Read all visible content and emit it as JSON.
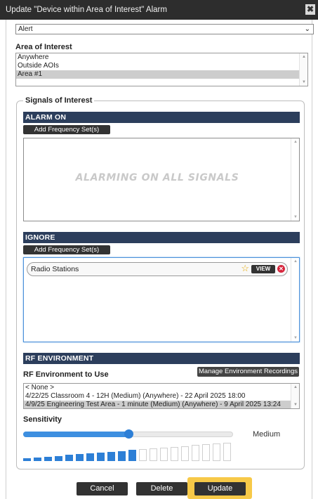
{
  "titlebar": {
    "title": "Update \"Device within Area of Interest\" Alarm",
    "close": "✖"
  },
  "alarm_type": {
    "value": "Alert",
    "arrow": "⌄"
  },
  "aoi": {
    "label": "Area of Interest",
    "options": [
      "Anywhere",
      "Outside AOIs",
      "Area #1"
    ],
    "selected_index": 2
  },
  "signals": {
    "legend": "Signals of Interest",
    "alarm_on": {
      "header": "ALARM ON",
      "add_button": "Add Frequency Set(s)",
      "placeholder": "ALARMING ON ALL SIGNALS"
    },
    "ignore": {
      "header": "IGNORE",
      "add_button": "Add Frequency Set(s)",
      "items": [
        {
          "label": "Radio Stations",
          "view_label": "VIEW"
        }
      ]
    },
    "rf": {
      "header": "RF ENVIRONMENT",
      "label": "RF Environment to Use",
      "manage_button": "Manage Environment Recordings",
      "options": [
        "< None >",
        "4/22/25 Classroom 4 - 12H (Medium) (Anywhere) - 22 April 2025 18:00",
        "4/9/25 Engineering Test Area - 1 minute (Medium) (Anywhere) - 9 April 2025 13:24"
      ],
      "selected_index": 2
    },
    "sensitivity": {
      "label": "Sensitivity",
      "level_text": "Medium",
      "slider_fraction": 0.5,
      "total_bars": 20,
      "active_bars": 11
    }
  },
  "footer": {
    "cancel": "Cancel",
    "delete": "Delete",
    "update": "Update"
  },
  "colors": {
    "header_bar": "#2c3e5c",
    "accent_blue": "#2d7fd6",
    "update_highlight": "#f7c948",
    "remove_red": "#d7263d"
  }
}
